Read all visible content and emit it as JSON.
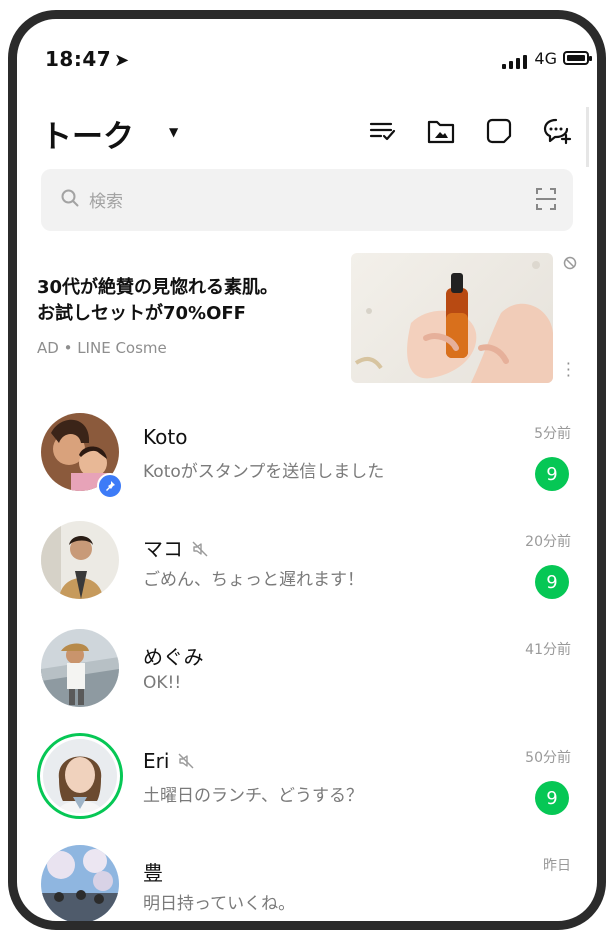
{
  "status_bar": {
    "time": "18:47",
    "network": "4G"
  },
  "header": {
    "title": "トーク"
  },
  "search": {
    "placeholder": "検索"
  },
  "ad": {
    "headline_line1": "30代が絶賛の見惚れる素肌。",
    "headline_line2": "お試しセットが70%OFF",
    "source": "AD • LINE Cosme"
  },
  "chats": [
    {
      "name": "Koto",
      "message": "Kotoがスタンプを送信しました",
      "time": "5分前",
      "unread": "9",
      "muted": false
    },
    {
      "name": "マコ",
      "message": "ごめん、ちょっと遅れます！",
      "time": "20分前",
      "unread": "9",
      "muted": true
    },
    {
      "name": "めぐみ",
      "message": "OK!!",
      "time": "41分前",
      "unread": "",
      "muted": false
    },
    {
      "name": "Eri",
      "message": "土曜日のランチ、どうする？",
      "time": "50分前",
      "unread": "9",
      "muted": true
    },
    {
      "name": "豊",
      "message": "明日持っていくね。",
      "time": "昨日",
      "unread": "",
      "muted": false
    }
  ],
  "colors": {
    "accent": "#06c755",
    "pin": "#3d7bf7",
    "text": "#111111",
    "muted_text": "#7a7a7a"
  }
}
